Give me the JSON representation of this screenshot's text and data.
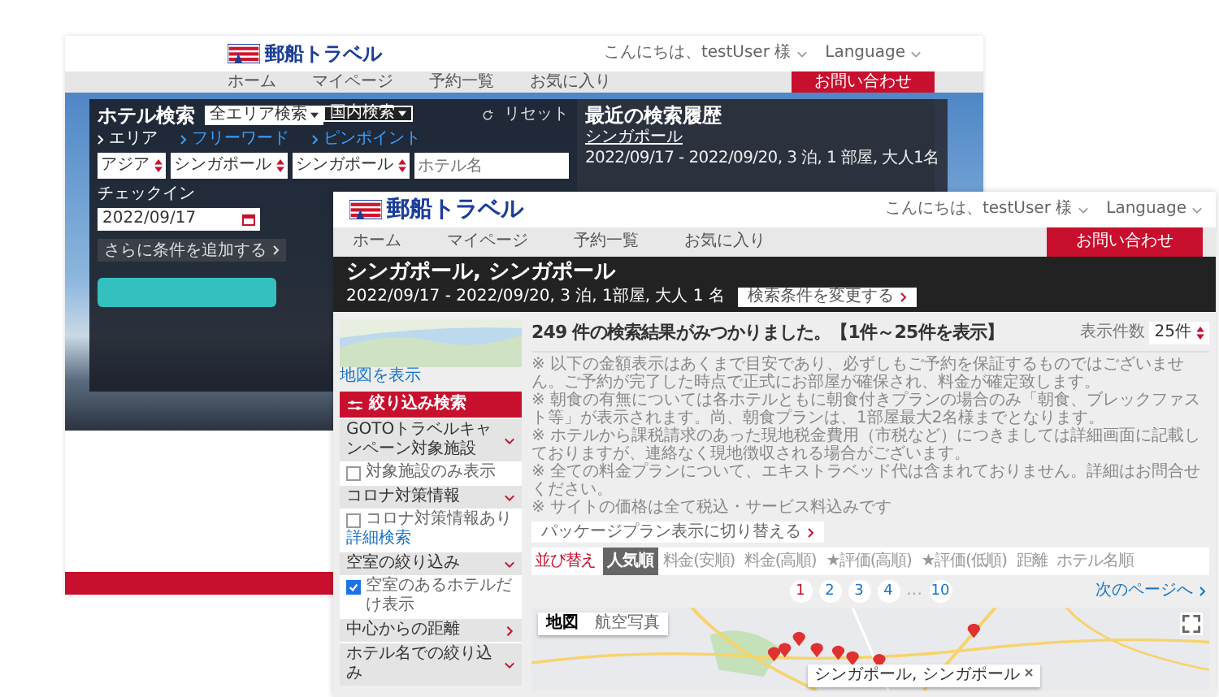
{
  "back_window": {
    "logo": "郵船トラベル",
    "greeting": "こんにちは、testUser 様",
    "language": "Language",
    "nav": [
      "ホーム",
      "マイページ",
      "予約一覧",
      "お気に入り"
    ],
    "contact_button": "お問い合わせ",
    "search_panel": {
      "title": "ホテル検索",
      "toggles": [
        "全エリア検索",
        "国内検索"
      ],
      "reset": "リセット",
      "modes": [
        {
          "label": "エリア",
          "selected": true
        },
        {
          "label": "フリーワード",
          "selected": false
        },
        {
          "label": "ピンポイント",
          "selected": false
        }
      ],
      "selects": [
        "アジア",
        "シンガポール",
        "シンガポール"
      ],
      "hotel_name": {
        "placeholder": "ホテル名"
      },
      "checkin_label": "チェックイン",
      "checkin_date": "2022/09/17",
      "more_conditions": "さらに条件を追加する"
    },
    "recent": {
      "title": "最近の検索履歴",
      "items": [
        {
          "name": "シンガポール",
          "detail": "2022/09/17 - 2022/09/20, 3 泊, 1 部屋, 大人1名"
        }
      ]
    }
  },
  "front_window": {
    "logo": "郵船トラベル",
    "greeting": "こんにちは、testUser 様",
    "language": "Language",
    "nav": [
      "ホーム",
      "マイページ",
      "予約一覧",
      "お気に入り"
    ],
    "contact_button": "お問い合わせ",
    "search_summary": {
      "title": "シンガポール, シンガポール",
      "detail": "2022/09/17 - 2022/09/20, 3 泊, 1部屋, 大人 1 名",
      "change_button": "検索条件を変更する"
    },
    "sidebar": {
      "map_link": "地図を表示",
      "filter_title": "絞り込み検索",
      "sections": [
        {
          "title": "GOTOトラベルキャンペーン対象施設",
          "expanded": true,
          "options": [
            {
              "label": "対象施設のみ表示",
              "checked": false
            }
          ]
        },
        {
          "title": "コロナ対策情報",
          "expanded": true,
          "options": [
            {
              "label": "コロナ対策情報あり",
              "checked": false
            }
          ],
          "link": "詳細検索"
        },
        {
          "title": "空室の絞り込み",
          "expanded": true,
          "options": [
            {
              "label": "空室のあるホテルだけ表示",
              "checked": true
            }
          ]
        },
        {
          "title": "中心からの距離",
          "expanded": false
        },
        {
          "title": "ホテル名での絞り込み",
          "expanded": true
        }
      ]
    },
    "results_title": "249 件の検索結果がみつかりました。【1件～25件を表示】",
    "per_page": {
      "label": "表示件数",
      "value": "25件"
    },
    "notes": [
      "※ 以下の金額表示はあくまで目安であり、必ずしもご予約を保証するものではございません。ご予約が完了した時点で正式にお部屋が確保され、料金が確定致します。",
      "※ 朝食の有無については各ホテルともに朝食付きプランの場合のみ「朝食、ブレックファスト等」が表示されます。尚、朝食プランは、1部屋最大2名様までとなります。",
      "※ ホテルから課税請求のあった現地税金費用（市税など）につきましては詳細画面に記載しておりますが、連絡なく現地徴収される場合がございます。",
      "※ 全ての料金プランについて、エキストラベッド代は含まれておりません。詳細はお問合せください。",
      "※ サイトの価格は全て税込・サービス料込みです"
    ],
    "package_button": "パッケージプラン表示に切り替える",
    "sort": {
      "label": "並び替え",
      "options": [
        {
          "label": "人気順",
          "selected": true
        },
        {
          "label": "料金(安順)",
          "selected": false
        },
        {
          "label": "料金(高順)",
          "selected": false
        },
        {
          "label": "★評価(高順)",
          "selected": false
        },
        {
          "label": "★評価(低順)",
          "selected": false
        },
        {
          "label": "距離",
          "selected": false
        },
        {
          "label": "ホテル名順",
          "selected": false
        }
      ]
    },
    "pagination": {
      "pages": [
        {
          "kind": "page",
          "label": "1",
          "selected": true
        },
        {
          "kind": "page",
          "label": "2",
          "selected": false
        },
        {
          "kind": "page",
          "label": "3",
          "selected": false
        },
        {
          "kind": "page",
          "label": "4",
          "selected": false
        },
        {
          "kind": "gap",
          "label": "…",
          "selected": false
        },
        {
          "kind": "page",
          "label": "10",
          "selected": false
        }
      ],
      "next": "次のページへ"
    },
    "map": {
      "types": [
        {
          "label": "地図",
          "selected": true
        },
        {
          "label": "航空写真",
          "selected": false
        }
      ],
      "popup": "シンガポール, シンガポール"
    }
  }
}
